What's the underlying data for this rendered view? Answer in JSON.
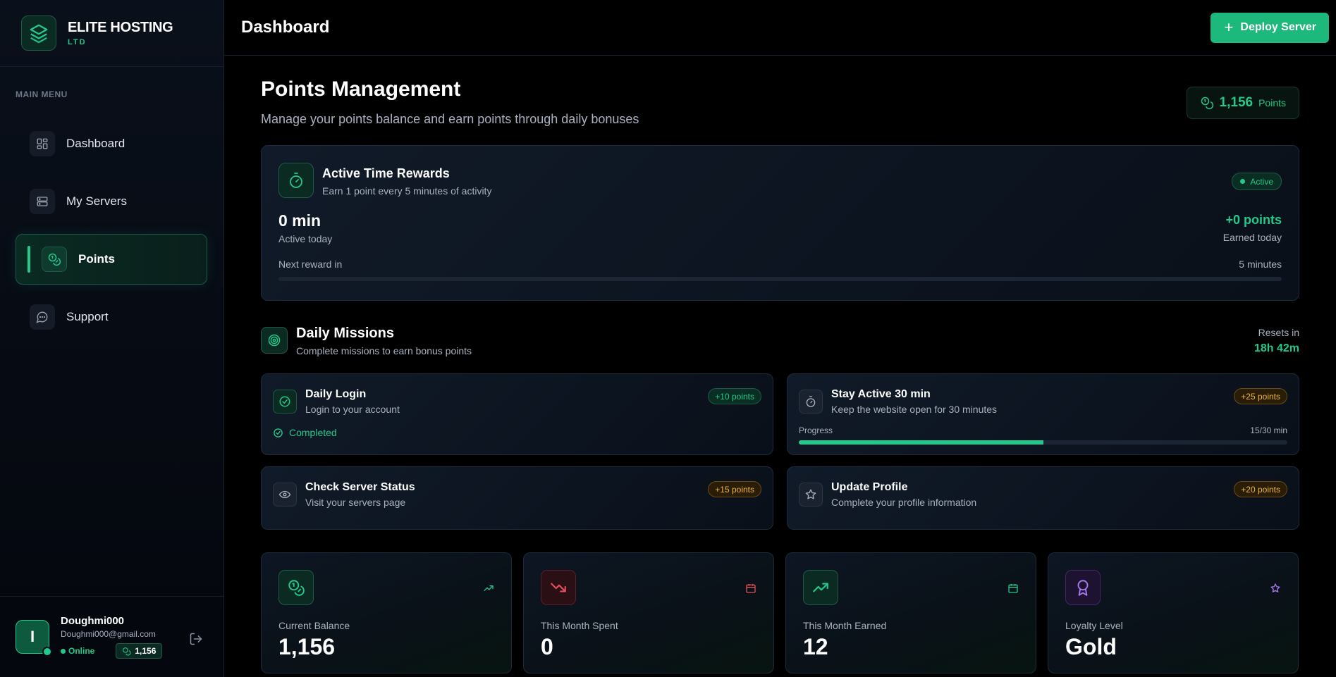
{
  "brand": {
    "name": "ELITE HOSTING",
    "sub": "LTD"
  },
  "sidebar": {
    "menu_label": "MAIN MENU",
    "items": [
      {
        "label": "Dashboard",
        "icon": "grid-icon",
        "active": false
      },
      {
        "label": "My Servers",
        "icon": "server-icon",
        "active": false
      },
      {
        "label": "Points",
        "icon": "coins-icon",
        "active": true
      },
      {
        "label": "Support",
        "icon": "chat-icon",
        "active": false
      }
    ]
  },
  "user": {
    "initial": "I",
    "name": "Doughmi000",
    "email": "Doughmi000@gmail.com",
    "status": "Online",
    "points": "1,156"
  },
  "topbar": {
    "title": "Dashboard",
    "deploy_label": "Deploy Server"
  },
  "page": {
    "title": "Points Management",
    "subtitle": "Manage your points balance and earn points through daily bonuses",
    "points_value": "1,156",
    "points_label": "Points"
  },
  "active_rewards": {
    "title": "Active Time Rewards",
    "subtitle": "Earn 1 point every 5 minutes of activity",
    "status": "Active",
    "active_value": "0 min",
    "active_label": "Active today",
    "earned_value": "+0 points",
    "earned_label": "Earned today",
    "next_label": "Next reward in",
    "next_value": "5 minutes",
    "progress_percent": 0
  },
  "missions": {
    "title": "Daily Missions",
    "subtitle": "Complete missions to earn bonus points",
    "reset_label": "Resets in",
    "reset_value": "18h 42m",
    "items": [
      {
        "title": "Daily Login",
        "subtitle": "Login to your account",
        "badge": "+10 points",
        "status": "Completed"
      },
      {
        "title": "Stay Active 30 min",
        "subtitle": "Keep the website open for 30 minutes",
        "badge": "+25 points",
        "progress_label": "Progress",
        "progress_value": "15/30 min",
        "progress_percent": 50
      },
      {
        "title": "Check Server Status",
        "subtitle": "Visit your servers page",
        "badge": "+15 points"
      },
      {
        "title": "Update Profile",
        "subtitle": "Complete your profile information",
        "badge": "+20 points"
      }
    ]
  },
  "stats": [
    {
      "label": "Current Balance",
      "value": "1,156"
    },
    {
      "label": "This Month Spent",
      "value": "0"
    },
    {
      "label": "This Month Earned",
      "value": "12"
    },
    {
      "label": "Loyalty Level",
      "value": "Gold"
    }
  ],
  "colors": {
    "accent": "#22c98a",
    "gold": "#f0b53a",
    "danger": "#e0505a",
    "purple": "#a878f0",
    "background": "#000000"
  }
}
